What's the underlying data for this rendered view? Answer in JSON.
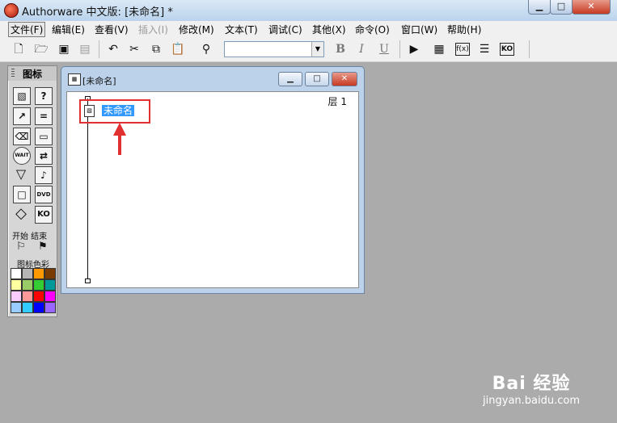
{
  "app": {
    "title": "Authorware 中文版: [未命名] *",
    "window_controls": [
      "minimize",
      "maximize",
      "close"
    ]
  },
  "menu": [
    {
      "label": "文件(F)",
      "active": true
    },
    {
      "label": "编辑(E)"
    },
    {
      "label": "查看(V)"
    },
    {
      "label": "插入(I)",
      "disabled": true
    },
    {
      "label": "修改(M)"
    },
    {
      "label": "文本(T)"
    },
    {
      "label": "调试(C)"
    },
    {
      "label": "其他(X)"
    },
    {
      "label": "命令(O)"
    },
    {
      "label": "窗口(W)"
    },
    {
      "label": "帮助(H)"
    }
  ],
  "toolbar": {
    "font_combo_value": "",
    "bold": "B",
    "italic": "I",
    "underline": "U",
    "fx_label": "f(x)",
    "ko_label": "KO"
  },
  "palette": {
    "title": "图标",
    "start_end_label": "开始 结束",
    "colors_label": "图标色彩",
    "wait_label": "WAIT",
    "dvd_label": "DVD",
    "ko_label": "KO",
    "swatches": [
      "#ffffff",
      "#b5b5b5",
      "#ff9900",
      "#7a3b00",
      "#ffffa0",
      "#99cc66",
      "#33cc33",
      "#009999",
      "#ffccff",
      "#ff9999",
      "#ff0000",
      "#ff00ff",
      "#99ccff",
      "#33ccff",
      "#0000ff",
      "#9966ff"
    ]
  },
  "design_window": {
    "title": "[未命名]",
    "layer_label": "层 1",
    "map_icon_label": "未命名"
  },
  "watermark": {
    "logo": "Bai 经验",
    "url": "jingyan.baidu.com"
  }
}
